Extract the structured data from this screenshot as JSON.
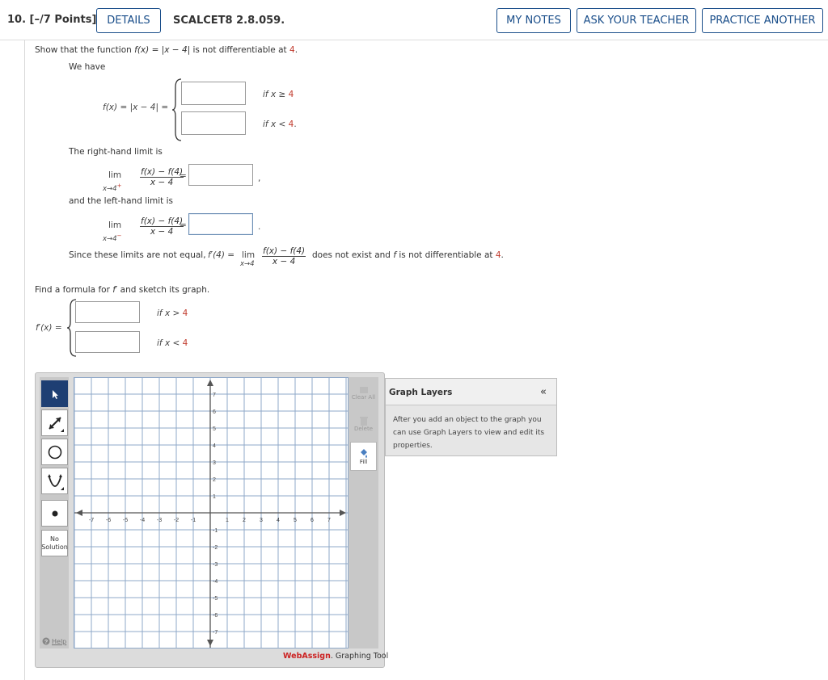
{
  "header": {
    "question_number": "10. [–/7 Points]",
    "details_label": "DETAILS",
    "code": "SCALCET8 2.8.059.",
    "my_notes_label": "MY NOTES",
    "ask_teacher_label": "ASK YOUR TEACHER",
    "practice_label": "PRACTICE ANOTHER"
  },
  "part1": {
    "intro_a": "Show that the function",
    "intro_fx": "f(x) = |x − 4|",
    "intro_b": "is not differentiable at",
    "intro_point": "4",
    "intro_end": ".",
    "we_have": "We have",
    "piecewise_lhs": "f(x) = |x − 4| =",
    "cond1_a": "if x ≥",
    "cond1_b": "4",
    "cond2_a": "if x <",
    "cond2_b": "4",
    "cond2_end": ".",
    "right_hand": "The right-hand limit is",
    "lim": "lim",
    "lim_sub_right": "x→4",
    "lim_sup_right": "+",
    "frac_num": "f(x) − f(4)",
    "frac_den": "x − 4",
    "equals": "=",
    "comma": ",",
    "left_hand": "and the left-hand limit is",
    "lim_sub_left": "x→4",
    "lim_sup_left": "−",
    "period": ".",
    "since_a": "Since these limits are not equal,",
    "since_f": "f′(4) =",
    "since_lim": "lim",
    "since_lim_sub": "x→4",
    "since_b": "does not exist and",
    "since_f2": "f",
    "since_c": "is not differentiable at",
    "since_point": "4",
    "since_end": "."
  },
  "part2": {
    "find_a": "Find a formula for",
    "find_f": "f′",
    "find_b": "and sketch its graph.",
    "lhs": "f′(x) =",
    "cond1_a": "if x >",
    "cond1_b": "4",
    "cond2_a": "if x <",
    "cond2_b": "4"
  },
  "graph": {
    "x_ticks": [
      "-7",
      "-6",
      "-5",
      "-4",
      "-3",
      "-2",
      "-1",
      "1",
      "2",
      "3",
      "4",
      "5",
      "6",
      "7"
    ],
    "y_ticks_pos": [
      "7",
      "6",
      "5",
      "4",
      "3",
      "2",
      "1"
    ],
    "y_ticks_neg": [
      "-1",
      "-2",
      "-3",
      "-4",
      "-5",
      "-6",
      "-7"
    ],
    "no_solution": "No\nSolution",
    "help": "Help",
    "clear": "Clear All",
    "delete": "Delete",
    "fill": "Fill",
    "brand_a": "WebAssign",
    "brand_b": ". Graphing Tool"
  },
  "layers": {
    "title": "Graph Layers",
    "collapse": "«",
    "body": "After you add an object to the graph you can use Graph Layers to view and edit its properties."
  },
  "colors": {
    "accent": "#1a4e8a",
    "red_text": "#c0392b",
    "selected_tool": "#1e3f73",
    "grid_line": "#8fa8c8",
    "brand_red": "#cc2222"
  }
}
